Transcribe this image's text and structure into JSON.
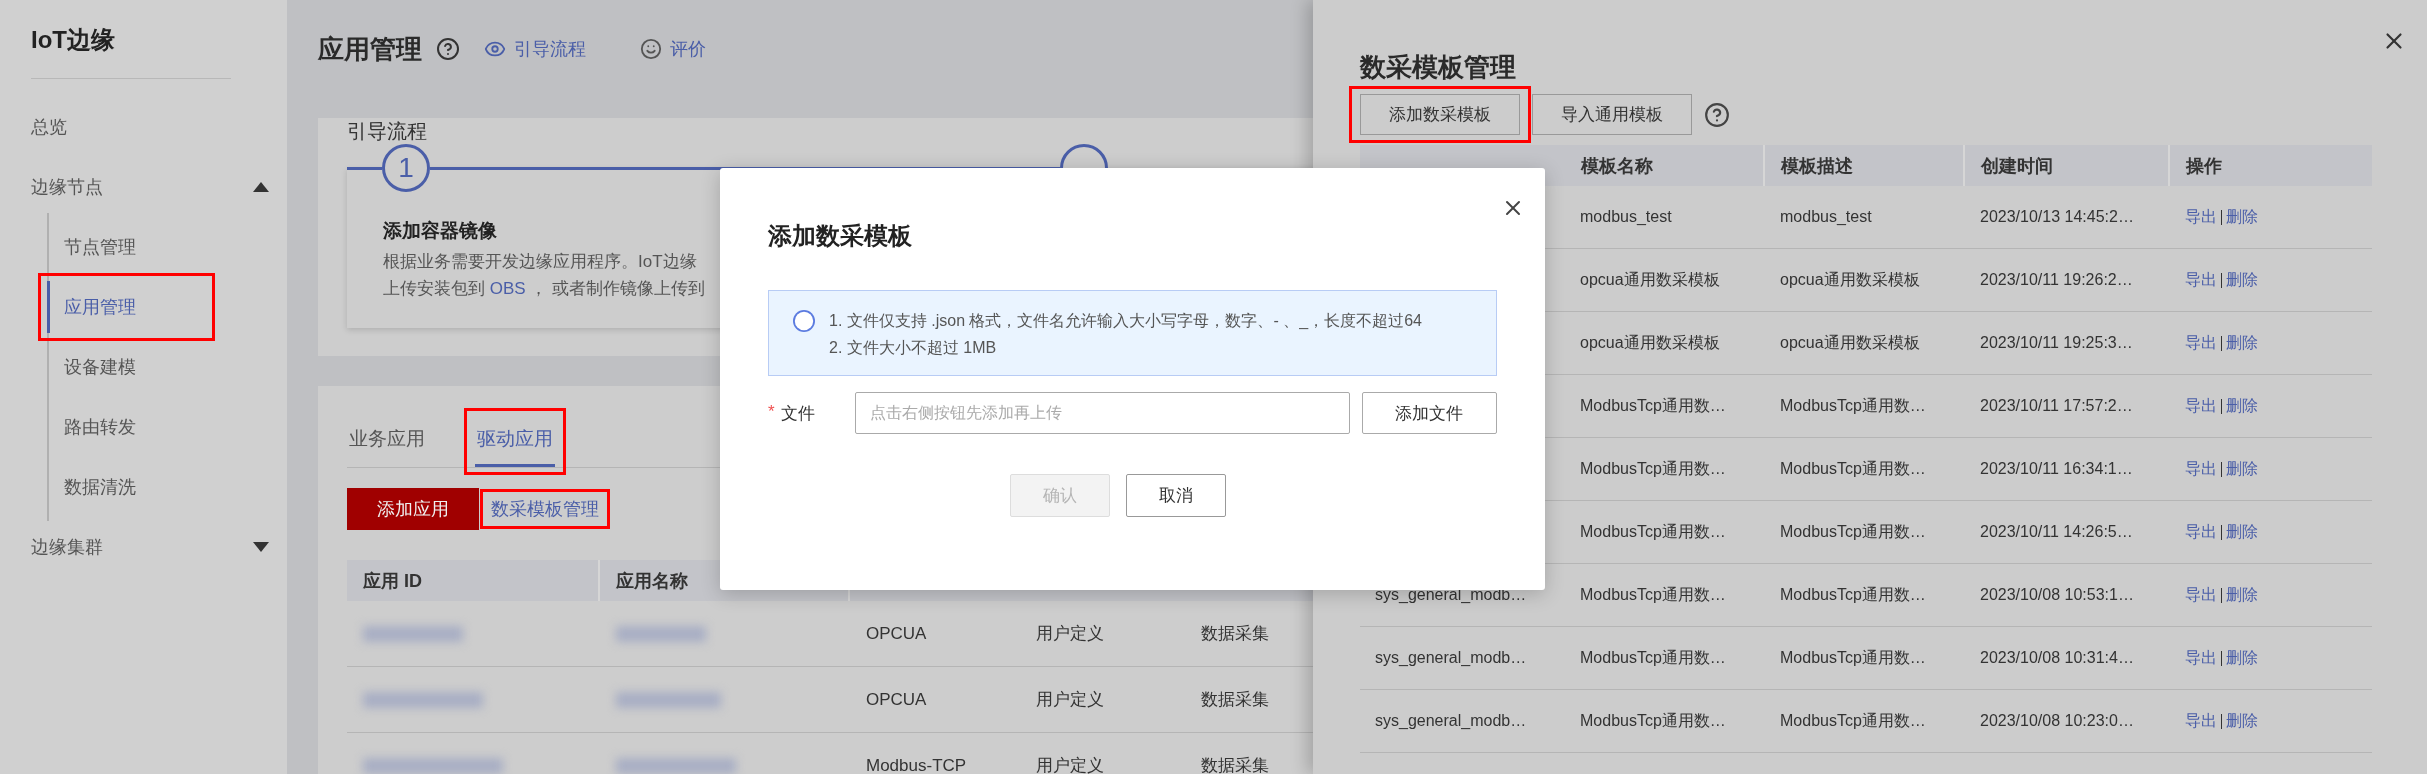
{
  "sidebar": {
    "title": "IoT边缘",
    "items": [
      {
        "label": "总览",
        "selected": false,
        "highlighted": false
      },
      {
        "label": "边缘节点",
        "expanded": true,
        "selected": false,
        "highlighted": false,
        "children": [
          {
            "label": "节点管理",
            "selected": false,
            "highlighted": false
          },
          {
            "label": "应用管理",
            "selected": true,
            "highlighted": true
          },
          {
            "label": "设备建模",
            "selected": false,
            "highlighted": false
          },
          {
            "label": "路由转发",
            "selected": false,
            "highlighted": false
          },
          {
            "label": "数据清洗",
            "selected": false,
            "highlighted": false
          }
        ]
      },
      {
        "label": "边缘集群",
        "expanded": false,
        "selected": false,
        "highlighted": false
      }
    ]
  },
  "header": {
    "title": "应用管理",
    "guide_link": "引导流程",
    "rate_link": "评价"
  },
  "guide": {
    "title": "引导流程",
    "steps": [
      {
        "number": "1",
        "title": "添加容器镜像",
        "lines": [
          "根据业务需要开发边缘应用程序。IoT边缘",
          "上传安装包到 **OBS** ， 或者制作镜像上传到"
        ]
      }
    ]
  },
  "apps": {
    "tabs": [
      {
        "label": "业务应用",
        "selected": false,
        "highlighted": false
      },
      {
        "label": "驱动应用",
        "selected": true,
        "highlighted": true
      }
    ],
    "add_button": "添加应用",
    "template_link": {
      "label": "数采模板管理",
      "highlighted": true
    },
    "columns": [
      "应用 ID",
      "应用名称"
    ],
    "rows": [
      {
        "redacted": true,
        "column_3": "OPCUA",
        "column_4": "用户定义",
        "column_5": "数据采集"
      },
      {
        "redacted": true,
        "column_3": "OPCUA",
        "column_4": "用户定义",
        "column_5": "数据采集"
      },
      {
        "redacted": true,
        "column_3": "Modbus-TCP",
        "column_4": "用户定义",
        "column_5": "数据采集"
      }
    ]
  },
  "drawer": {
    "title": "数采模板管理",
    "buttons": [
      {
        "label": "添加数采模板",
        "highlighted": true
      },
      {
        "label": "导入通用模板",
        "highlighted": false
      }
    ],
    "columns": [
      "模板名称",
      "模板描述",
      "创建时间",
      "操作"
    ],
    "rows": [
      {
        "name": "modbus_test",
        "description": "modbus_test",
        "created": "2023/10/13 14:45:2…",
        "export": "导出",
        "delete": "删除"
      },
      {
        "name": "opcua通用数采模板",
        "description": "opcua通用数采模板",
        "created": "2023/10/11 19:26:2…",
        "export": "导出",
        "delete": "删除"
      },
      {
        "name": "opcua通用数采模板",
        "description": "opcua通用数采模板",
        "created": "2023/10/11 19:25:3…",
        "export": "导出",
        "delete": "删除"
      },
      {
        "name": "ModbusTcp通用数…",
        "description": "ModbusTcp通用数…",
        "created": "2023/10/11 17:57:2…",
        "export": "导出",
        "delete": "删除"
      },
      {
        "name": "ModbusTcp通用数…",
        "description": "ModbusTcp通用数…",
        "created": "2023/10/11 16:34:1…",
        "export": "导出",
        "delete": "删除"
      },
      {
        "name": "ModbusTcp通用数…",
        "description": "ModbusTcp通用数…",
        "created": "2023/10/11 14:26:5…",
        "export": "导出",
        "delete": "删除"
      },
      {
        "template_id": "sys_general_modb…",
        "name": "ModbusTcp通用数…",
        "description": "ModbusTcp通用数…",
        "created": "2023/10/08 10:53:1…",
        "export": "导出",
        "delete": "删除"
      },
      {
        "template_id": "sys_general_modb…",
        "name": "ModbusTcp通用数…",
        "description": "ModbusTcp通用数…",
        "created": "2023/10/08 10:31:4…",
        "export": "导出",
        "delete": "删除"
      },
      {
        "template_id": "sys_general_modb…",
        "name": "ModbusTcp通用数…",
        "description": "ModbusTcp通用数…",
        "created": "2023/10/08 10:23:0…",
        "export": "导出",
        "delete": "删除"
      }
    ]
  },
  "dialog": {
    "title": "添加数采模板",
    "notes": [
      "1. 文件仅支持 .json 格式，文件名允许输入大小写字母，数字、- 、_，长度不超过64",
      "2. 文件大小不超过 1MB"
    ],
    "field": {
      "label": "文件",
      "required_mark": "*",
      "placeholder": "点击右侧按钮先添加再上传"
    },
    "add_file_button": "添加文件",
    "buttons": [
      {
        "label": "确认",
        "disabled": true
      },
      {
        "label": "取消",
        "disabled": false
      }
    ]
  }
}
